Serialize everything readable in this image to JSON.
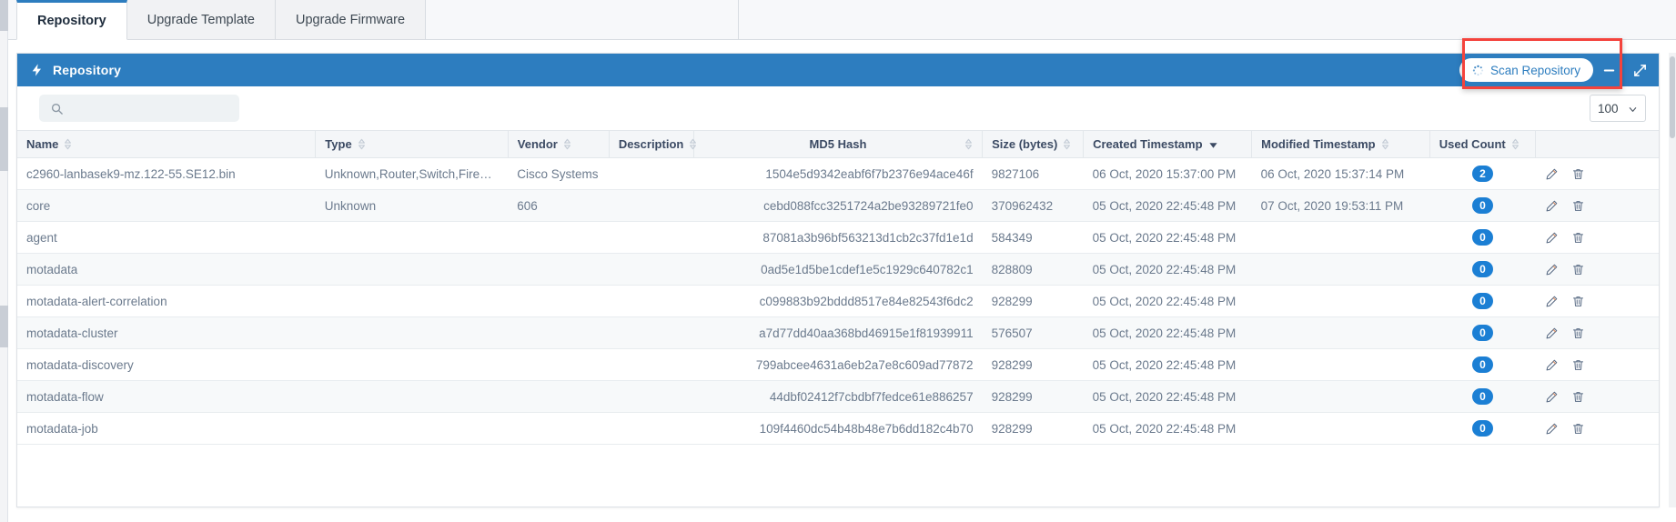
{
  "tabs": [
    {
      "label": "Repository",
      "active": true
    },
    {
      "label": "Upgrade Template",
      "active": false
    },
    {
      "label": "Upgrade Firmware",
      "active": false
    }
  ],
  "card": {
    "title": "Repository",
    "scan_button_label": "Scan Repository",
    "minimize_label": "Minimize",
    "expand_label": "Expand",
    "header_color": "#2d7dbf",
    "accent_color": "#1b7fd4"
  },
  "toolbar": {
    "search_value": "",
    "search_placeholder": "",
    "page_size": "100"
  },
  "table": {
    "columns": [
      {
        "label": "Name",
        "align": "left",
        "sort": "none"
      },
      {
        "label": "Type",
        "align": "left",
        "sort": "none"
      },
      {
        "label": "Vendor",
        "align": "left",
        "sort": "none"
      },
      {
        "label": "Description",
        "align": "left",
        "sort": "none"
      },
      {
        "label": "MD5 Hash",
        "align": "center",
        "sort": "none"
      },
      {
        "label": "Size (bytes)",
        "align": "left",
        "sort": "none"
      },
      {
        "label": "Created Timestamp",
        "align": "left",
        "sort": "desc"
      },
      {
        "label": "Modified Timestamp",
        "align": "left",
        "sort": "none"
      },
      {
        "label": "Used Count",
        "align": "left",
        "sort": "none"
      },
      {
        "label": "",
        "align": "left",
        "sort": "hidden"
      }
    ],
    "rows": [
      {
        "name": "c2960-lanbasek9-mz.122-55.SE12.bin",
        "type": "Unknown,Router,Switch,Firewall",
        "vendor": "Cisco Systems",
        "description": "",
        "md5": "1504e5d9342eabf6f7b2376e94ace46f",
        "size": "9827106",
        "created": "06 Oct, 2020 15:37:00 PM",
        "modified": "06 Oct, 2020 15:37:14 PM",
        "used_count": "2"
      },
      {
        "name": "core",
        "type": "Unknown",
        "vendor": "606",
        "description": "",
        "md5": "cebd088fcc3251724a2be93289721fe0",
        "size": "370962432",
        "created": "05 Oct, 2020 22:45:48 PM",
        "modified": "07 Oct, 2020 19:53:11 PM",
        "used_count": "0"
      },
      {
        "name": "agent",
        "type": "",
        "vendor": "",
        "description": "",
        "md5": "87081a3b96bf563213d1cb2c37fd1e1d",
        "size": "584349",
        "created": "05 Oct, 2020 22:45:48 PM",
        "modified": "",
        "used_count": "0"
      },
      {
        "name": "motadata",
        "type": "",
        "vendor": "",
        "description": "",
        "md5": "0ad5e1d5be1cdef1e5c1929c640782c1",
        "size": "828809",
        "created": "05 Oct, 2020 22:45:48 PM",
        "modified": "",
        "used_count": "0"
      },
      {
        "name": "motadata-alert-correlation",
        "type": "",
        "vendor": "",
        "description": "",
        "md5": "c099883b92bddd8517e84e82543f6dc2",
        "size": "928299",
        "created": "05 Oct, 2020 22:45:48 PM",
        "modified": "",
        "used_count": "0"
      },
      {
        "name": "motadata-cluster",
        "type": "",
        "vendor": "",
        "description": "",
        "md5": "a7d77dd40aa368bd46915e1f81939911",
        "size": "576507",
        "created": "05 Oct, 2020 22:45:48 PM",
        "modified": "",
        "used_count": "0"
      },
      {
        "name": "motadata-discovery",
        "type": "",
        "vendor": "",
        "description": "",
        "md5": "799abcee4631a6eb2a7e8c609ad77872",
        "size": "928299",
        "created": "05 Oct, 2020 22:45:48 PM",
        "modified": "",
        "used_count": "0"
      },
      {
        "name": "motadata-flow",
        "type": "",
        "vendor": "",
        "description": "",
        "md5": "44dbf02412f7cbdbf7fedce61e886257",
        "size": "928299",
        "created": "05 Oct, 2020 22:45:48 PM",
        "modified": "",
        "used_count": "0"
      },
      {
        "name": "motadata-job",
        "type": "",
        "vendor": "",
        "description": "",
        "md5": "109f4460dc54b48b48e7b6dd182c4b70",
        "size": "928299",
        "created": "05 Oct, 2020 22:45:48 PM",
        "modified": "",
        "used_count": "0"
      }
    ],
    "row_actions": {
      "edit": "Edit",
      "delete": "Delete"
    }
  },
  "annotation": {
    "color": "#f4433c"
  }
}
